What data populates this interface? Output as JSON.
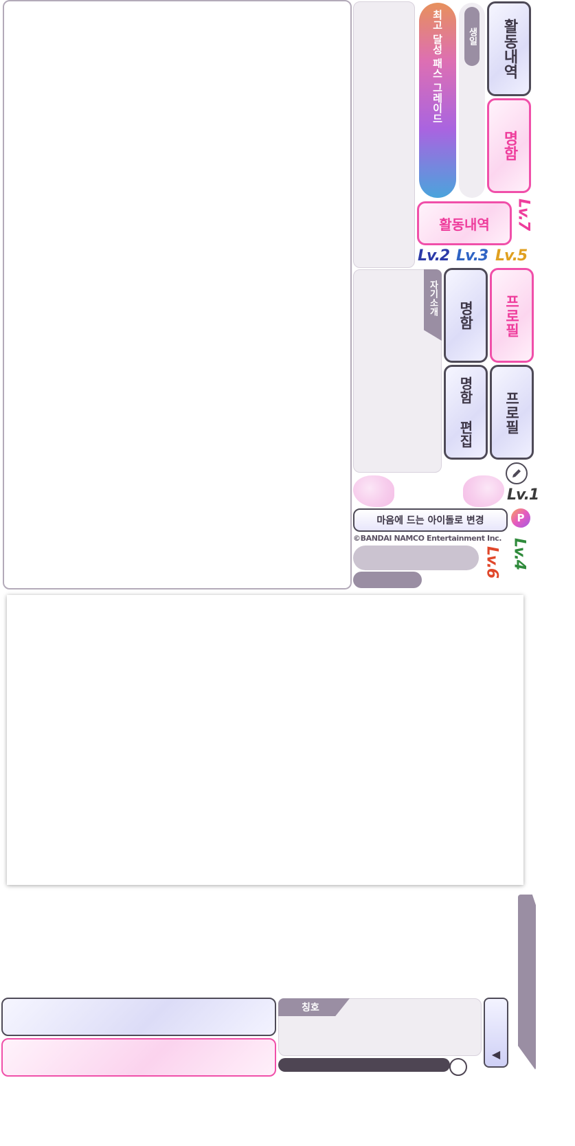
{
  "labels": {
    "activity_history_vertical": "활동내역",
    "business_card_pink_vertical": "명함",
    "birthday_tag": "생일",
    "best_pass_grade": "최고 달성 패스 그레이드",
    "activity_history_pink": "활동내역",
    "self_intro_tag": "자기소개",
    "business_card_gray": "명함",
    "profile_pink": "프로필",
    "business_card_edit": "명함 편집",
    "profile_gray": "프로필",
    "change_favorite_idol": "마음에 드는 아이돌로 변경",
    "copyright": "©BANDAI NAMCO Entertainment Inc.",
    "title_tag": "칭호",
    "points_icon_glyph": "P",
    "triangle_glyph": "◀"
  },
  "levels": {
    "lv1": "Lv.1",
    "lv2": "Lv.2",
    "lv3": "Lv.3",
    "lv4": "Lv.4",
    "lv5": "Lv.5",
    "lv6": "Lv.6",
    "lv7": "Lv.7"
  },
  "colors": {
    "pink": "#ee3d9c",
    "dark_outline": "#4e4a57",
    "mauve": "#9a8ea3",
    "lv1": "#3b3b3b",
    "lv2": "#2c3aa8",
    "lv3": "#2f64c4",
    "lv4": "#2f8a3b",
    "lv5": "#e0a020",
    "lv6": "#e0472a",
    "lv7": "#ee3d9c"
  }
}
